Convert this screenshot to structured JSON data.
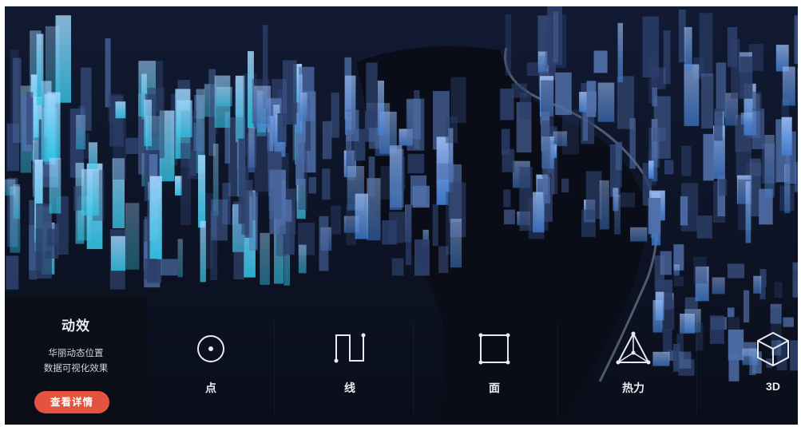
{
  "panel": {
    "title": "动效",
    "desc_line1": "华丽动态位置",
    "desc_line2": "数据可视化效果",
    "button_label": "查看详情",
    "button_color": "#e4533d"
  },
  "features": [
    {
      "label": "点",
      "icon": "point-icon"
    },
    {
      "label": "线",
      "icon": "line-icon"
    },
    {
      "label": "面",
      "icon": "polygon-icon"
    },
    {
      "label": "热力",
      "icon": "heatmap-icon"
    },
    {
      "label": "3D",
      "icon": "cube-3d-icon"
    }
  ],
  "colors": {
    "background": "#0c1120",
    "building_light": "#7b9bd8",
    "building_cyan": "#56d3ee",
    "river": "#8896b0"
  }
}
